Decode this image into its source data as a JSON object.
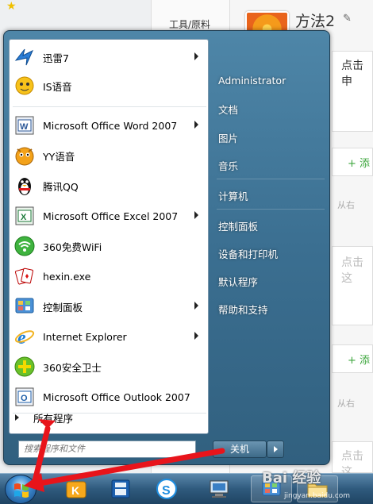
{
  "background": {
    "tools_label": "工具/原料",
    "method_title": "方法2",
    "card1_text": "点击申",
    "card2_text": "点击这",
    "card3_text": "点击这",
    "add_label": "+ 添",
    "from_label": "从右"
  },
  "start_menu": {
    "programs": [
      {
        "label": "迅雷7",
        "icon": "thunder-icon",
        "arrow": true
      },
      {
        "label": "IS语音",
        "icon": "is-voice-icon",
        "arrow": false
      },
      {
        "label": "Microsoft Office Word 2007",
        "icon": "word-icon",
        "arrow": true
      },
      {
        "label": "YY语音",
        "icon": "yy-voice-icon",
        "arrow": false
      },
      {
        "label": "腾讯QQ",
        "icon": "qq-penguin-icon",
        "arrow": false
      },
      {
        "label": "Microsoft Office Excel 2007",
        "icon": "excel-icon",
        "arrow": true
      },
      {
        "label": "360免费WiFi",
        "icon": "wifi-icon",
        "arrow": false
      },
      {
        "label": "hexin.exe",
        "icon": "cards-icon",
        "arrow": false
      },
      {
        "label": "控制面板",
        "icon": "control-panel-icon",
        "arrow": true
      },
      {
        "label": "Internet Explorer",
        "icon": "ie-icon",
        "arrow": true
      },
      {
        "label": "360安全卫士",
        "icon": "360-guard-icon",
        "arrow": false
      },
      {
        "label": "Microsoft Office Outlook 2007",
        "icon": "outlook-icon",
        "arrow": false
      }
    ],
    "all_programs": "所有程序",
    "search_placeholder": "搜索程序和文件",
    "right_links": [
      "Administrator",
      "文档",
      "图片",
      "音乐",
      "计算机",
      "控制面板",
      "设备和打印机",
      "默认程序",
      "帮助和支持"
    ],
    "shutdown_label": "关机"
  },
  "watermark": {
    "brand": "Bai 经验",
    "url": "jingyan.baidu.com"
  },
  "colors": {
    "menu_blue": "#3b6f91",
    "annotation_red": "#e8141b"
  }
}
